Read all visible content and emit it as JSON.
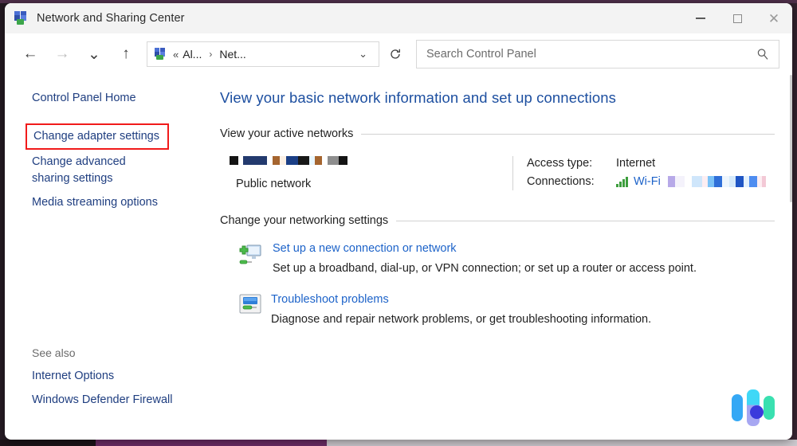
{
  "window": {
    "title": "Network and Sharing Center",
    "icon": "network-sharing-icon",
    "controls": {
      "minimize_label": "–",
      "maximize_label": "□",
      "close_label": "✕"
    }
  },
  "nav": {
    "back_label": "←",
    "forward_label": "→",
    "recent_label": "⌄",
    "up_label": "↑",
    "refresh_label": "↻",
    "address": {
      "icon": "control-panel-icon",
      "chevrons": "«",
      "crumb_1": "Al...",
      "separator": "›",
      "crumb_2": "Net...",
      "dropdown_label": "⌄"
    }
  },
  "search": {
    "placeholder": "Search Control Panel",
    "value": "",
    "icon": "search-icon"
  },
  "sidebar": {
    "home_label": "Control Panel Home",
    "items": [
      {
        "label": "Change adapter settings",
        "highlighted": true
      },
      {
        "label": "Change advanced sharing settings",
        "highlighted": false
      },
      {
        "label": "Media streaming options",
        "highlighted": false
      }
    ],
    "see_also": {
      "title": "See also",
      "items": [
        {
          "label": "Internet Options"
        },
        {
          "label": "Windows Defender Firewall"
        }
      ]
    },
    "highlight_color": "#f11a1a"
  },
  "content": {
    "heading": "View your basic network information and set up connections",
    "active_networks": {
      "section_title": "View your active networks",
      "network_name_redacted": true,
      "network_type": "Public network",
      "details": [
        {
          "label": "Access type:",
          "value": "Internet"
        },
        {
          "label": "Connections:",
          "value": "Wi-Fi",
          "icon": "wifi-signal-icon",
          "is_link": true,
          "redacted_suffix": true
        }
      ]
    },
    "networking_settings": {
      "section_title": "Change your networking settings",
      "actions": [
        {
          "icon": "new-connection-icon",
          "title": "Set up a new connection or network",
          "description": "Set up a broadband, dial-up, or VPN connection; or set up a router or access point."
        },
        {
          "icon": "troubleshoot-icon",
          "title": "Troubleshoot problems",
          "description": "Diagnose and repair network problems, or get troubleshooting information."
        }
      ]
    }
  },
  "assistant_widget": {
    "name": "assistant-widget-icon",
    "colors": [
      "#35a8f5",
      "#3fd8f7",
      "#9b9bf0",
      "#3ae0b0",
      "#3b3bdc"
    ]
  },
  "colors": {
    "link": "#1d63c9",
    "heading": "#1d4fa0",
    "sidebar_link": "#1f3e80",
    "titlebar_bg": "#f3f3f3"
  }
}
